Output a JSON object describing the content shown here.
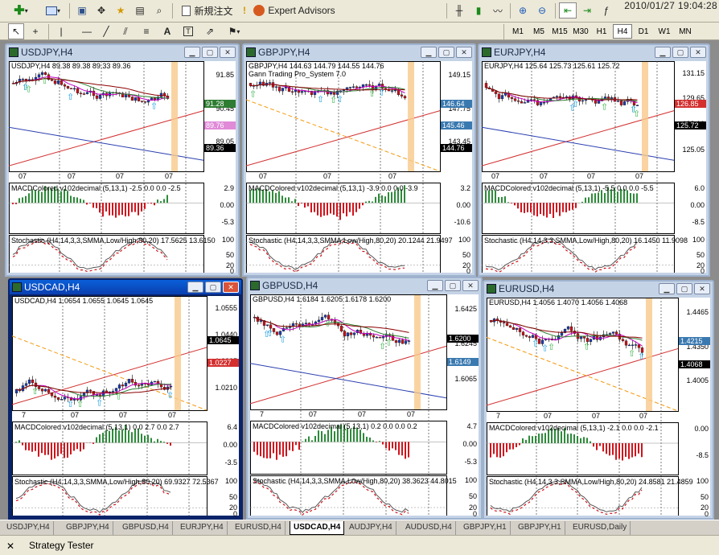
{
  "toolbar": {
    "new_order": "新規注文",
    "expert_advisors": "Expert Advisors",
    "clock": "2010/01/27 19:04:28",
    "timeframes": [
      "M1",
      "M5",
      "M15",
      "M30",
      "H1",
      "H4",
      "D1",
      "W1",
      "MN"
    ],
    "active_timeframe": "H4"
  },
  "windows": [
    {
      "title": "USDJPY,H4",
      "header": "USDJPY,H4  89.38 89.38 89.33 89.36",
      "ticks": [
        "91.85",
        "90.45",
        "89.05"
      ],
      "prices": [
        {
          "text": "91.28",
          "color": "#2e7d32"
        },
        {
          "text": "89.76",
          "color": "#e08ad8"
        },
        {
          "text": "89.36",
          "color": "#000000"
        }
      ],
      "dates": [
        "07",
        "07",
        "07",
        "07"
      ],
      "macd": "MACDColored v102decimal (5,13,1) -2.5 0.0 0.0 -2.5",
      "macd_ticks": [
        "2.9",
        "0.00",
        "-5.3"
      ],
      "stoch": "Stochastic (H4,14,3,3,SMMA,Low/High,80,20) 17.5625 13.6150",
      "stoch_ticks": [
        "100",
        "50",
        "20",
        "0"
      ]
    },
    {
      "title": "GBPJPY,H4",
      "header": "GBPJPY,H4  144.63 144.79 144.55 144.76",
      "subheader": "Gann Trading Pro_System 7.0",
      "ticks": [
        "149.15",
        "147.75",
        "143.45"
      ],
      "prices": [
        {
          "text": "146.64",
          "color": "#3a79b0"
        },
        {
          "text": "145.46",
          "color": "#3a79b0"
        },
        {
          "text": "144.76",
          "color": "#000000"
        }
      ],
      "dates": [
        "07",
        "07",
        "07"
      ],
      "macd": "MACDColored v102decimal (5,13,1) -3.9 0.0 0.0 -3.9",
      "macd_ticks": [
        "3.2",
        "0.00",
        "-10.6"
      ],
      "stoch": "Stochastic (H4,14,3,3,SMMA,Low/High,80,20) 20.1244 21.9497",
      "stoch_ticks": [
        "100",
        "50",
        "20",
        "0"
      ]
    },
    {
      "title": "EURJPY,H4",
      "header": "EURJPY,H4  125.64 125.73 125.61 125.72",
      "ticks": [
        "131.15",
        "129.65",
        "128.10",
        "125.05"
      ],
      "prices": [
        {
          "text": "126.85",
          "color": "#d32f2f"
        },
        {
          "text": "125.72",
          "color": "#000000"
        }
      ],
      "dates": [
        "07",
        "07",
        "07",
        "07"
      ],
      "macd": "MACDColored v102decimal (5,13,1) -5.5 0.0 0.0 -5.5",
      "macd_ticks": [
        "6.0",
        "0.00",
        "-8.5"
      ],
      "stoch": "Stochastic (H4,14,3,3,SMMA,Low/High,80,20) 16.1450 11.9098",
      "stoch_ticks": [
        "100",
        "50",
        "20",
        "0"
      ]
    },
    {
      "title": "USDCAD,H4",
      "header": "USDCAD,H4  1.0654 1.0655 1.0645 1.0645",
      "ticks": [
        "1.0555",
        "1.0440",
        "1.0325",
        "1.0210"
      ],
      "prices": [
        {
          "text": "1.0645",
          "color": "#000000"
        },
        {
          "text": "1.0227",
          "color": "#d32f2f"
        }
      ],
      "dates": [
        "7",
        "07",
        "07",
        "07"
      ],
      "macd": "MACDColored v102decimal (5,13,1) 0.0 2.7 0.0 2.7",
      "macd_ticks": [
        "6.4",
        "0.00",
        "-3.5"
      ],
      "stoch": "Stochastic (H4,14,3,3,SMMA,Low/High,80,20) 69.9327 72.5367",
      "stoch_ticks": [
        "100",
        "50",
        "20",
        "0"
      ]
    },
    {
      "title": "GBPUSD,H4",
      "header": "GBPUSD,H4  1.6184 1.6205 1.6178 1.6200",
      "ticks": [
        "1.6425",
        "1.6245",
        "1.6065"
      ],
      "prices": [
        {
          "text": "1.6200",
          "color": "#000000"
        },
        {
          "text": "1.6149",
          "color": "#3a79b0"
        }
      ],
      "dates": [
        "7",
        "07",
        "07",
        "07"
      ],
      "macd": "MACDColored v102decimal (5,13,1) 0.2 0.0 0.0 0.2",
      "macd_ticks": [
        "4.7",
        "0.00",
        "-5.3"
      ],
      "stoch": "Stochastic (H4,14,3,3,SMMA,Low/High,80,20) 38.3623 44.8015",
      "stoch_ticks": [
        "100",
        "50",
        "20",
        "0"
      ]
    },
    {
      "title": "EURUSD,H4",
      "header": "EURUSD,H4  1.4056 1.4070 1.4056 1.4068",
      "ticks": [
        "1.4465",
        "1.4350",
        "1.4005"
      ],
      "prices": [
        {
          "text": "1.4215",
          "color": "#3a79b0"
        },
        {
          "text": "1.4068",
          "color": "#000000"
        }
      ],
      "dates": [
        "7",
        "07",
        "07",
        "07"
      ],
      "macd": "MACDColored v102decimal (5,13,1) -2.1 0.0 0.0 -2.1",
      "macd_ticks": [
        "0.00",
        "-8.5"
      ],
      "stoch": "Stochastic (H4,14,3,3,SMMA,Low/High,80,20) 24.8581 21.4859",
      "stoch_ticks": [
        "100",
        "50",
        "20",
        "0"
      ]
    }
  ],
  "tabs": [
    "USDJPY,H4",
    "GBPJPY,H4",
    "GBPUSD,H4",
    "EURJPY,H4",
    "EURUSD,H4",
    "USDCAD,H4",
    "AUDJPY,H4",
    "AUDUSD,H4",
    "GBPJPY,H1",
    "GBPJPY,H1",
    "EURUSD,Daily"
  ],
  "active_tab": "USDCAD,H4",
  "status": {
    "label": "Strategy Tester"
  }
}
